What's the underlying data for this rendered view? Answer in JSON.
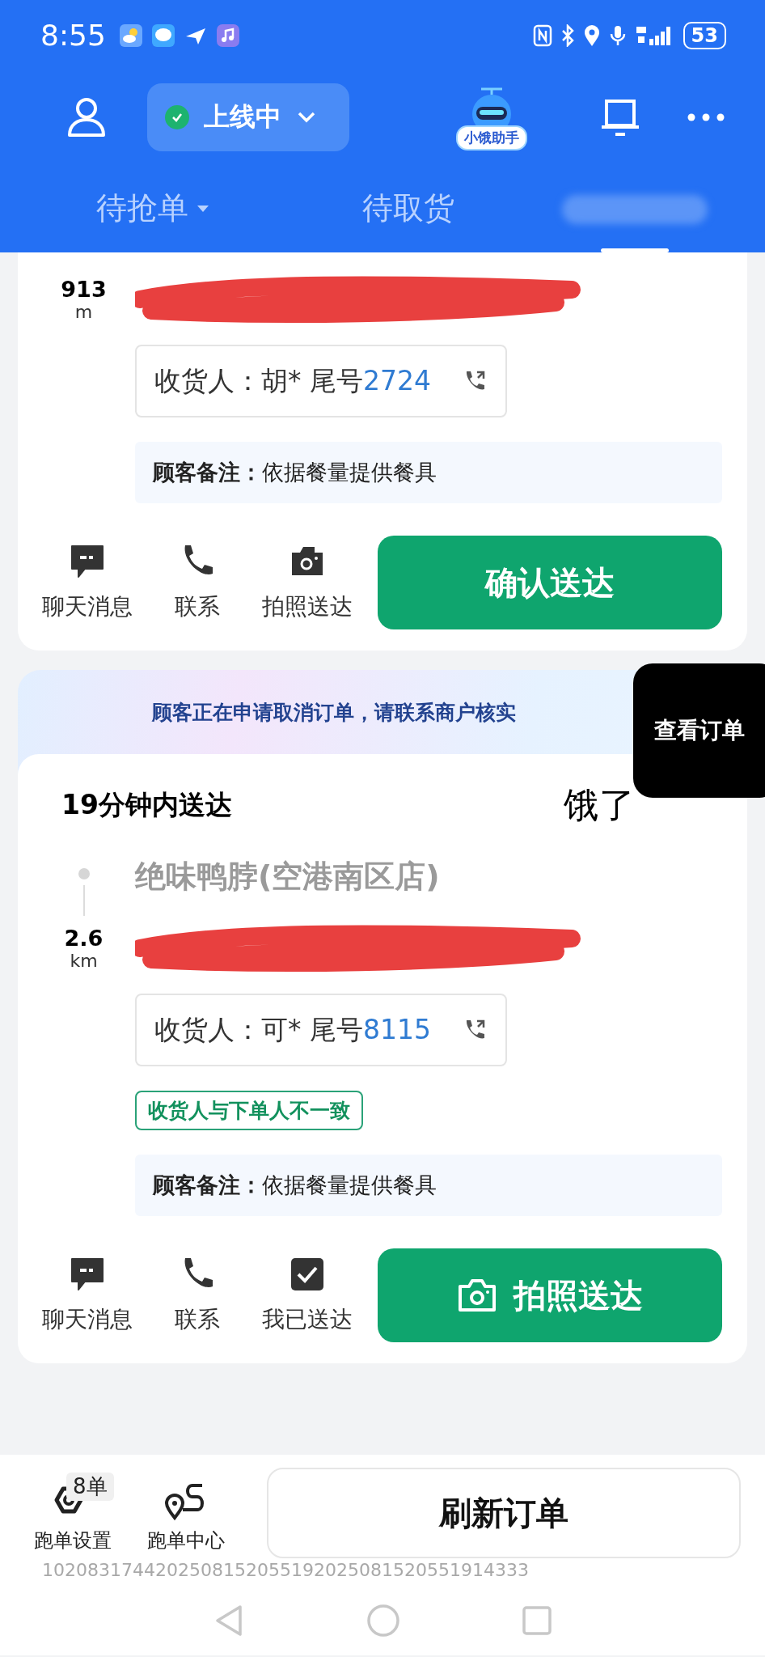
{
  "status_bar": {
    "time": "8:55",
    "battery": "53"
  },
  "header": {
    "status_label": "上线中",
    "online": true,
    "assistant_label": "小饿助手"
  },
  "tabs": [
    {
      "kind": "text",
      "label": "待抢单",
      "dropdown": true,
      "selected": false
    },
    {
      "kind": "text",
      "label": "待取货",
      "dropdown": false,
      "selected": false
    },
    {
      "kind": "blurred",
      "selected": true
    }
  ],
  "orders": [
    {
      "distance": "913",
      "distance_unit": "m",
      "receiver_label": "收货人：",
      "receiver_name": "胡*",
      "tail_label": "尾号",
      "phone_tail": "2724",
      "note_label": "顾客备注：",
      "note": "依据餐量提供餐具",
      "actions": [
        {
          "kind": "chat",
          "label": "聊天消息"
        },
        {
          "kind": "phone",
          "label": "联系"
        },
        {
          "kind": "camera",
          "label": "拍照送达"
        }
      ],
      "primary": {
        "label": "确认送达",
        "kind": "plain"
      }
    },
    {
      "notice": "顾客正在申请取消订单，请联系商户核实",
      "eta": "19分钟内送达",
      "platform": "饿了",
      "store": "绝味鸭脖(空港南区店)",
      "distance": "2.6",
      "distance_unit": "km",
      "receiver_label": "收货人：",
      "receiver_name": "可*",
      "tail_label": "尾号",
      "phone_tail": "8115",
      "tag": "收货人与下单人不一致",
      "note_label": "顾客备注：",
      "note": "依据餐量提供餐具",
      "actions": [
        {
          "kind": "chat",
          "label": "聊天消息"
        },
        {
          "kind": "phone",
          "label": "联系"
        },
        {
          "kind": "check",
          "label": "我已送达"
        }
      ],
      "primary": {
        "label": "拍照送达",
        "kind": "camera"
      }
    }
  ],
  "floating_button": {
    "label": "查看订单"
  },
  "bottom_bar": {
    "items": [
      {
        "kind": "settings",
        "label": "跑单设置",
        "badge": "8单"
      },
      {
        "kind": "route",
        "label": "跑单中心"
      }
    ],
    "refresh": "刷新订单",
    "code": "1020831744202508152055192025081520551914333"
  }
}
